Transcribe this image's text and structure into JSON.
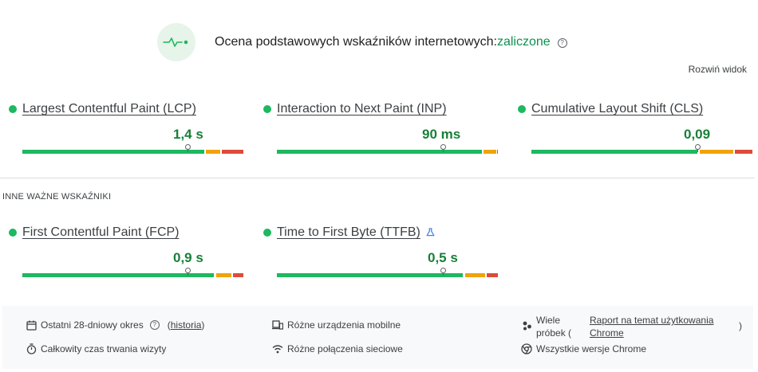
{
  "header": {
    "title": "Ocena podstawowych wskaźników internetowych:",
    "status": "zaliczone",
    "help": "?",
    "icon": "pulse-icon"
  },
  "expand_label": "Rozwiń widok",
  "core_metrics": [
    {
      "name": "Largest Contentful Paint (LCP)",
      "value": "1,4 s"
    },
    {
      "name": "Interaction to Next Paint (INP)",
      "value": "90 ms"
    },
    {
      "name": "Cumulative Layout Shift (CLS)",
      "value": "0,09"
    }
  ],
  "other_section": {
    "label": "INNE WAŻNE WSKAŹNIKI",
    "metrics": [
      {
        "name": "First Contentful Paint (FCP)",
        "value": "0,9 s"
      },
      {
        "name": "Time to First Byte (TTFB)",
        "value": "0,5 s",
        "badge_icon": "flask-icon"
      }
    ]
  },
  "footer": {
    "period_label": "Ostatni 28-dniowy okres",
    "period_help": "?",
    "history_open": "(",
    "history_link": "historia",
    "history_close": ")",
    "visit_duration": "Całkowity czas trwania wizyty",
    "devices": "Różne urządzenia mobilne",
    "connections": "Różne połączenia sieciowe",
    "samples_prefix": "Wiele próbek (",
    "report_link": "Raport na temat użytkowania Chrome",
    "samples_suffix": ")",
    "chrome_versions": "Wszystkie wersje Chrome"
  },
  "colors": {
    "good": "#1db85f",
    "needs_improvement": "#f0a30a",
    "poor": "#dd4b39",
    "pass_text": "#0d904f",
    "value_text": "#188038"
  }
}
